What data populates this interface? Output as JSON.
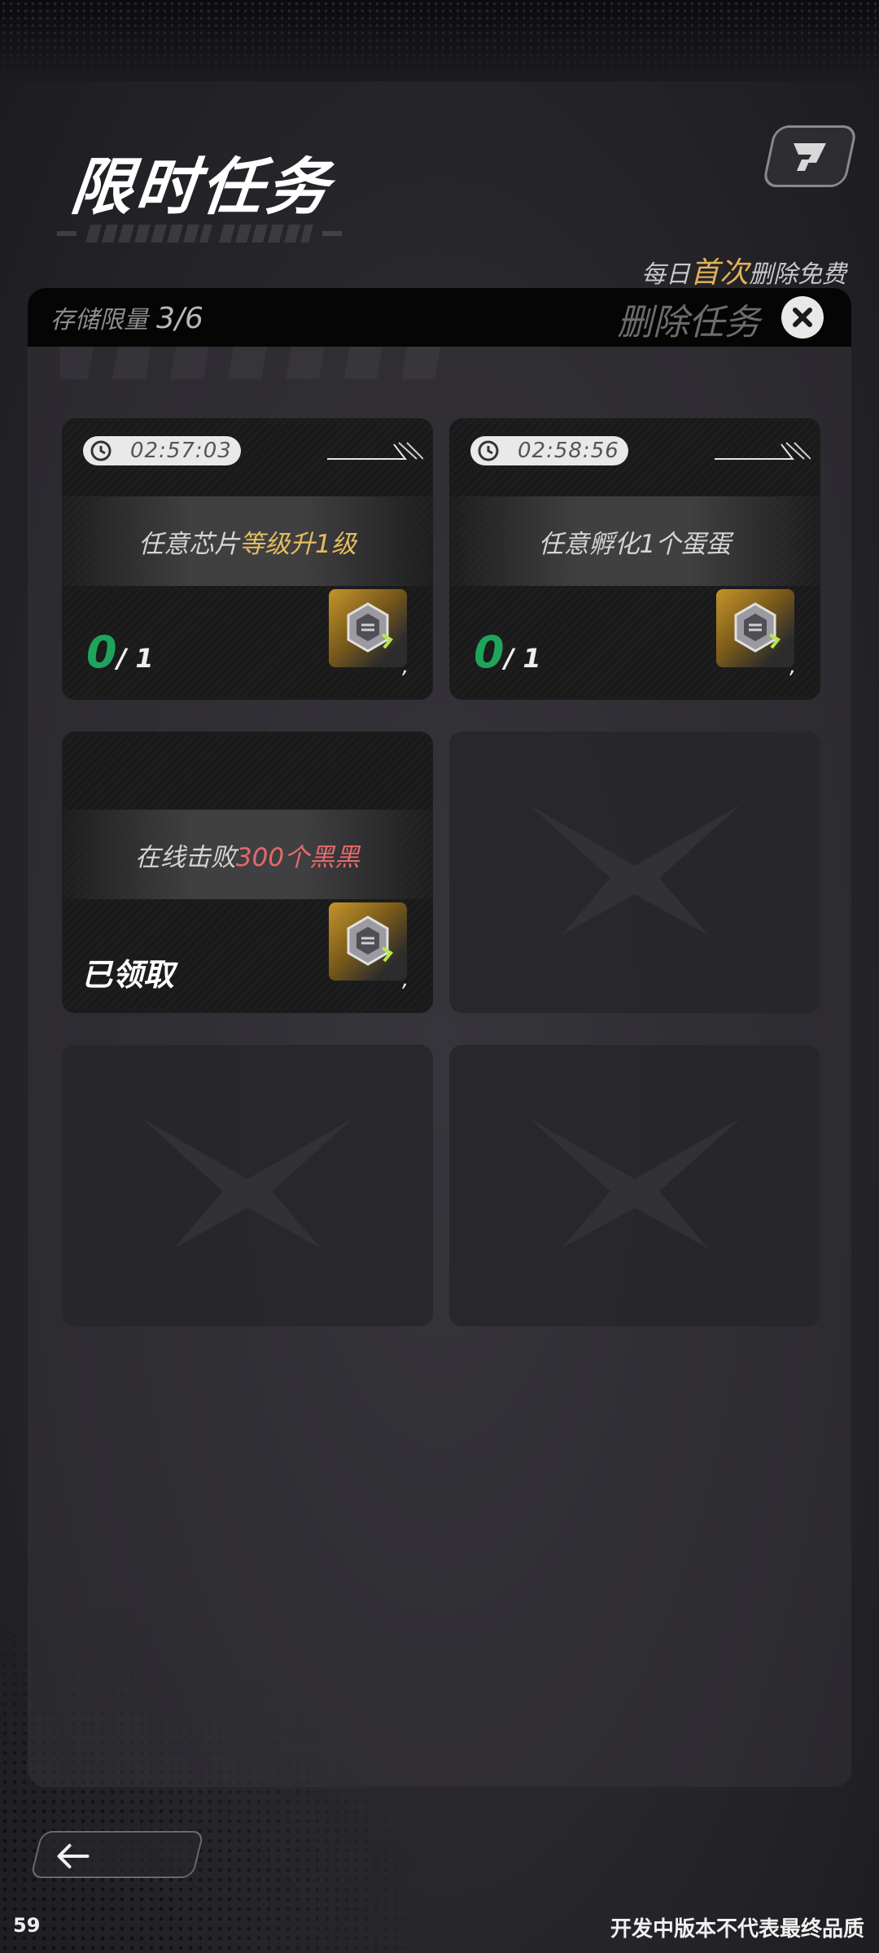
{
  "header": {
    "title": "限时任务",
    "daily_note": {
      "prefix": "每日",
      "highlight": "首次",
      "suffix": "删除免费"
    }
  },
  "panel": {
    "storage_label": "存储限量",
    "storage_value": "3/6",
    "delete_label": "删除任务"
  },
  "tasks": [
    {
      "timer": "02:57:03",
      "text_prefix": "任意芯片",
      "text_highlight": "等级升1级",
      "highlight_color": "#e6bd5c",
      "progress_current": "0",
      "progress_total": "/ 1",
      "reward_icon": "chip-reward-icon"
    },
    {
      "timer": "02:58:56",
      "text_prefix": "任意孵化",
      "text_highlight": "1个蛋蛋",
      "highlight_color": "#d5d5d5",
      "progress_current": "0",
      "progress_total": "/ 1",
      "reward_icon": "chip-reward-icon"
    },
    {
      "text_prefix": "在线击败",
      "text_highlight": "300个黑黑",
      "highlight_color": "#e36a6a",
      "status": "已领取",
      "reward_icon": "chip-reward-icon"
    }
  ],
  "reward_tick": ",",
  "footer": {
    "page_number": "59",
    "note": "开发中版本不代表最终品质"
  }
}
